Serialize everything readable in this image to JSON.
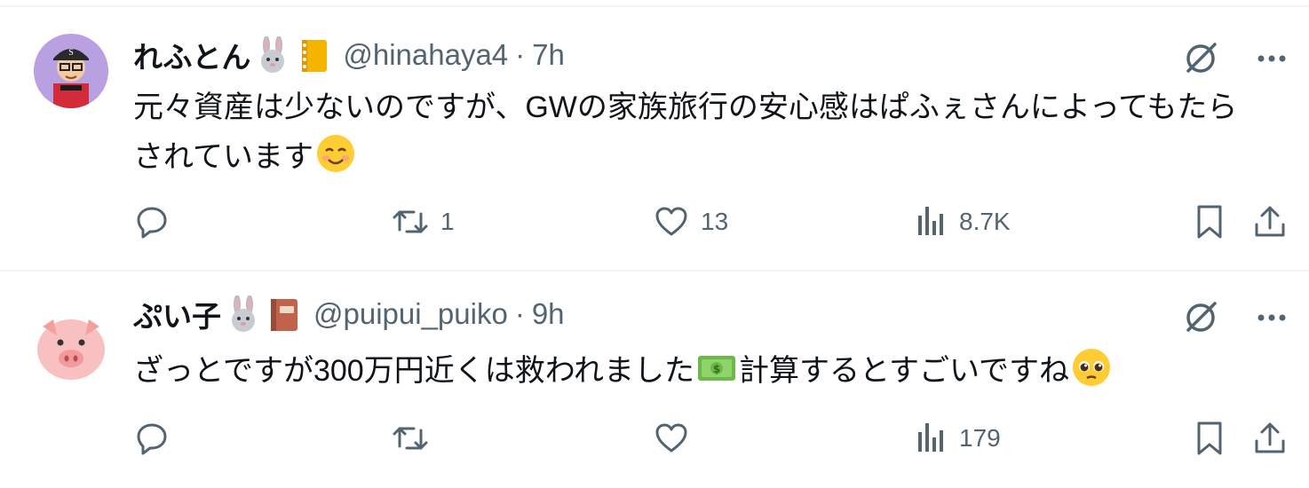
{
  "tweets": [
    {
      "display_name": "れふとん",
      "badges": [
        "rabbit-emoji",
        "notebook-emoji"
      ],
      "handle": "@hinahaya4",
      "separator": "·",
      "time": "7h",
      "text_before_emoji": "元々資産は少ないのですが、GWの家族旅行の安心感はぱふぇさんによってもたらされています",
      "text_after_emoji": "",
      "inline_emoji": "smiling-face-emoji",
      "counts": {
        "reply": "",
        "retweet": "1",
        "like": "13",
        "views": "8.7K"
      }
    },
    {
      "display_name": "ぷい子",
      "badges": [
        "rabbit-emoji",
        "book-emoji"
      ],
      "handle": "@puipui_puiko",
      "separator": "·",
      "time": "9h",
      "text_before_emoji": "ざっとですが300万円近くは救われました",
      "text_after_emoji": "計算するとすごいですね",
      "inline_emoji": "money-emoji",
      "trailing_emoji": "pleading-face-emoji",
      "counts": {
        "reply": "",
        "retweet": "",
        "like": "",
        "views": "179"
      }
    }
  ],
  "colors": {
    "text": "#0f1419",
    "secondary": "#536471",
    "border": "#eff3f4"
  }
}
